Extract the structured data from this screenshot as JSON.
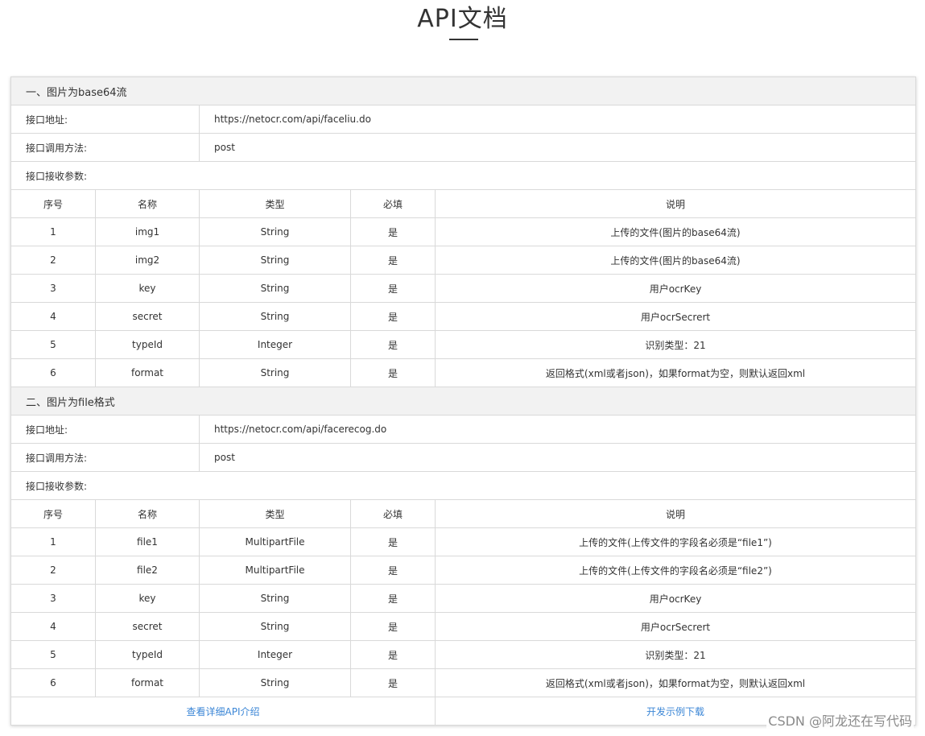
{
  "page": {
    "title": "API文档"
  },
  "sections": [
    {
      "header": "一、图片为base64流",
      "address_label": "接口地址:",
      "address_value": "https://netocr.com/api/faceliu.do",
      "method_label": "接口调用方法:",
      "method_value": "post",
      "params_label": "接口接收参数:",
      "columns": [
        "序号",
        "名称",
        "类型",
        "必填",
        "说明"
      ],
      "rows": [
        [
          "1",
          "img1",
          "String",
          "是",
          "上传的文件(图片的base64流)"
        ],
        [
          "2",
          "img2",
          "String",
          "是",
          "上传的文件(图片的base64流)"
        ],
        [
          "3",
          "key",
          "String",
          "是",
          "用户ocrKey"
        ],
        [
          "4",
          "secret",
          "String",
          "是",
          "用户ocrSecrert"
        ],
        [
          "5",
          "typeId",
          "Integer",
          "是",
          "识别类型：21"
        ],
        [
          "6",
          "format",
          "String",
          "是",
          "返回格式(xml或者json)，如果format为空，则默认返回xml"
        ]
      ]
    },
    {
      "header": "二、图片为file格式",
      "address_label": "接口地址:",
      "address_value": "https://netocr.com/api/facerecog.do",
      "method_label": "接口调用方法:",
      "method_value": "post",
      "params_label": "接口接收参数:",
      "columns": [
        "序号",
        "名称",
        "类型",
        "必填",
        "说明"
      ],
      "rows": [
        [
          "1",
          "file1",
          "MultipartFile",
          "是",
          "上传的文件(上传文件的字段名必须是“file1”)"
        ],
        [
          "2",
          "file2",
          "MultipartFile",
          "是",
          "上传的文件(上传文件的字段名必须是“file2”)"
        ],
        [
          "3",
          "key",
          "String",
          "是",
          "用户ocrKey"
        ],
        [
          "4",
          "secret",
          "String",
          "是",
          "用户ocrSecrert"
        ],
        [
          "5",
          "typeId",
          "Integer",
          "是",
          "识别类型：21"
        ],
        [
          "6",
          "format",
          "String",
          "是",
          "返回格式(xml或者json)，如果format为空，则默认返回xml"
        ]
      ]
    }
  ],
  "footer": {
    "detail_link": "查看详细API介绍",
    "download_link": "开发示例下载"
  },
  "watermark": "CSDN @阿龙还在写代码",
  "colors": {
    "link": "#3b86d6",
    "header_bg": "#f2f2f2",
    "border": "#d9d9d9"
  }
}
